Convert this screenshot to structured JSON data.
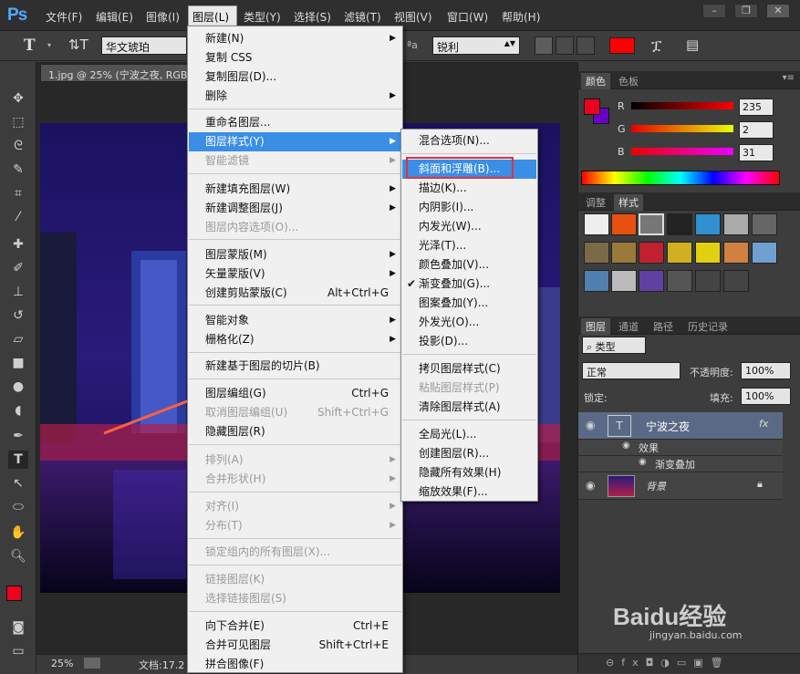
{
  "app": {
    "logo": "Ps"
  },
  "menubar": {
    "items": [
      "文件(F)",
      "编辑(E)",
      "图像(I)",
      "图层(L)",
      "类型(Y)",
      "选择(S)",
      "滤镜(T)",
      "视图(V)",
      "窗口(W)",
      "帮助(H)"
    ]
  },
  "window_controls": {
    "minimize": "–",
    "restore": "❐",
    "close": "✕"
  },
  "options_bar": {
    "font_family": "华文琥珀",
    "antialias": "锐利",
    "text_color": "#ff0000"
  },
  "document": {
    "tab_title": "1.jpg @ 25% (宁波之夜, RGB",
    "zoom": "25%",
    "doc_info": "文档:17.2"
  },
  "layer_menu": {
    "items": [
      {
        "label": "新建(N)",
        "submenu": true
      },
      {
        "label": "复制 CSS"
      },
      {
        "label": "复制图层(D)..."
      },
      {
        "label": "删除",
        "submenu": true
      },
      {
        "label": "重命名图层..."
      },
      {
        "label": "图层样式(Y)",
        "submenu": true
      },
      {
        "label": "智能滤镜",
        "submenu": true,
        "disabled": true
      },
      {
        "label": "新建填充图层(W)",
        "submenu": true
      },
      {
        "label": "新建调整图层(J)",
        "submenu": true
      },
      {
        "label": "图层内容选项(O)...",
        "disabled": true
      },
      {
        "label": "图层蒙版(M)",
        "submenu": true
      },
      {
        "label": "矢量蒙版(V)",
        "submenu": true
      },
      {
        "label": "创建剪贴蒙版(C)",
        "shortcut": "Alt+Ctrl+G"
      },
      {
        "label": "智能对象",
        "submenu": true
      },
      {
        "label": "栅格化(Z)",
        "submenu": true
      },
      {
        "label": "新建基于图层的切片(B)"
      },
      {
        "label": "图层编组(G)",
        "shortcut": "Ctrl+G"
      },
      {
        "label": "取消图层编组(U)",
        "shortcut": "Shift+Ctrl+G",
        "disabled": true
      },
      {
        "label": "隐藏图层(R)"
      },
      {
        "label": "排列(A)",
        "submenu": true,
        "disabled": true
      },
      {
        "label": "合并形状(H)",
        "submenu": true,
        "disabled": true
      },
      {
        "label": "对齐(I)",
        "submenu": true,
        "disabled": true
      },
      {
        "label": "分布(T)",
        "submenu": true,
        "disabled": true
      },
      {
        "label": "锁定组内的所有图层(X)...",
        "disabled": true
      },
      {
        "label": "链接图层(K)",
        "disabled": true
      },
      {
        "label": "选择链接图层(S)",
        "disabled": true
      },
      {
        "label": "向下合并(E)",
        "shortcut": "Ctrl+E"
      },
      {
        "label": "合并可见图层",
        "shortcut": "Shift+Ctrl+E"
      },
      {
        "label": "拼合图像(F)"
      }
    ]
  },
  "style_submenu": {
    "items": [
      {
        "label": "混合选项(N)..."
      },
      {
        "label": "斜面和浮雕(B)..."
      },
      {
        "label": "描边(K)..."
      },
      {
        "label": "内阴影(I)..."
      },
      {
        "label": "内发光(W)..."
      },
      {
        "label": "光泽(T)..."
      },
      {
        "label": "颜色叠加(V)..."
      },
      {
        "label": "渐变叠加(G)...",
        "checked": true
      },
      {
        "label": "图案叠加(Y)..."
      },
      {
        "label": "外发光(O)..."
      },
      {
        "label": "投影(D)..."
      },
      {
        "label": "拷贝图层样式(C)"
      },
      {
        "label": "粘贴图层样式(P)",
        "disabled": true
      },
      {
        "label": "清除图层样式(A)"
      },
      {
        "label": "全局光(L)..."
      },
      {
        "label": "创建图层(R)..."
      },
      {
        "label": "隐藏所有效果(H)"
      },
      {
        "label": "缩放效果(F)..."
      }
    ]
  },
  "color_panel": {
    "tabs": [
      "颜色",
      "色板"
    ],
    "r_label": "R",
    "g_label": "G",
    "b_label": "B",
    "r": "235",
    "g": "2",
    "b": "31",
    "fg_color": "#eb021f",
    "bg_color": "#6a00c8"
  },
  "styles_panel": {
    "tabs": [
      "调整",
      "样式"
    ]
  },
  "layers_panel": {
    "tabs": [
      "图层",
      "通道",
      "路径",
      "历史记录"
    ],
    "filter_kind": "类型",
    "blend_mode": "正常",
    "opacity_label": "不透明度:",
    "opacity": "100%",
    "lock_label": "锁定:",
    "fill_label": "填充:",
    "fill": "100%",
    "layers": [
      {
        "name": "宁波之夜",
        "type": "text",
        "fx": "fx"
      },
      {
        "name": "背景",
        "type": "image"
      }
    ],
    "effects_label": "效果",
    "effect_item": "渐变叠加"
  },
  "watermark": {
    "brand": "Baidu经验",
    "sub": "jingyan.baidu.com"
  }
}
